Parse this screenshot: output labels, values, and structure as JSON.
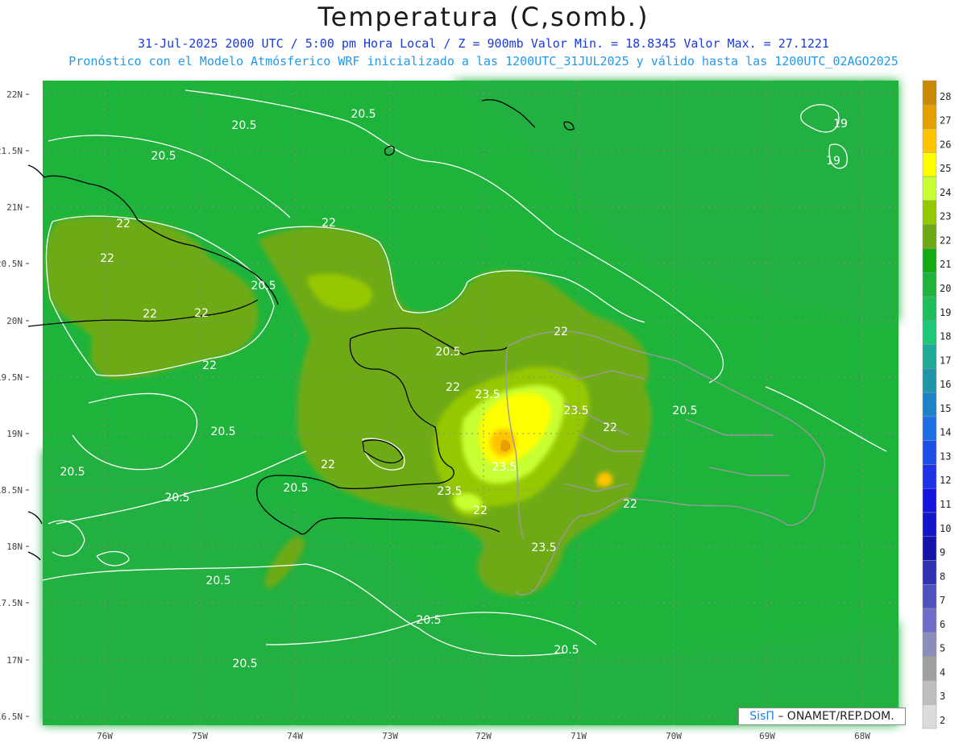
{
  "header": {
    "title": "Temperatura (C,somb.)",
    "line1": "31-Jul-2025   2000 UTC / 5:00 pm Hora Local / Z = 900mb     Valor Min. = 18.8345   Valor Max. = 27.1221",
    "line2": "Pronóstico con el Modelo Atmósferico WRF inicializado a las 1200UTC_31JUL2025 y válido hasta las  1200UTC_02AGO2025"
  },
  "credit": {
    "brand": "SisΠ",
    "rest": "– ONAMET/REP.DOM."
  },
  "map": {
    "lat_labels": [
      "22N",
      "21.5N",
      "21N",
      "20.5N",
      "20N",
      "19.5N",
      "19N",
      "18.5N",
      "18N",
      "17.5N",
      "17N",
      "16.5N"
    ],
    "lon_labels": [
      "76W",
      "75W",
      "74W",
      "73W",
      "72W",
      "71W",
      "70W",
      "69W",
      "68W"
    ],
    "contour_labels": [
      "20.5",
      "20.5",
      "20.5",
      "20.5",
      "20.5",
      "20.5",
      "20.5",
      "20.5",
      "20.5",
      "20.5",
      "20.5",
      "20.5",
      "20.5",
      "20.5",
      "22",
      "22",
      "22",
      "22",
      "22",
      "22",
      "22",
      "22",
      "22",
      "22",
      "22",
      "22",
      "23.5",
      "23.5",
      "23.5",
      "23.5",
      "23.5",
      "19",
      "19"
    ],
    "colorbar": {
      "levels": [
        "28",
        "27",
        "26",
        "25",
        "24",
        "23",
        "22",
        "21",
        "20",
        "19",
        "18",
        "17",
        "16",
        "15",
        "14",
        "13",
        "12",
        "11",
        "10",
        "9",
        "8",
        "7",
        "6",
        "5",
        "4",
        "3",
        "2"
      ],
      "colors": [
        "#c98a00",
        "#e5a000",
        "#ffc400",
        "#ffff00",
        "#c8ff32",
        "#96c800",
        "#6eaa14",
        "#14aa14",
        "#1eb43c",
        "#1ebe5a",
        "#1ec878",
        "#1eaa96",
        "#1e96aa",
        "#1e82c8",
        "#1e6ee6",
        "#1e50e6",
        "#1e32e6",
        "#1414dc",
        "#1414c8",
        "#1414aa",
        "#3232b4",
        "#5050be",
        "#6e6ec8",
        "#8c8cbe",
        "#a0a0a0",
        "#bebebe",
        "#dcdcdc"
      ]
    },
    "background_color": "#1eb43c"
  }
}
